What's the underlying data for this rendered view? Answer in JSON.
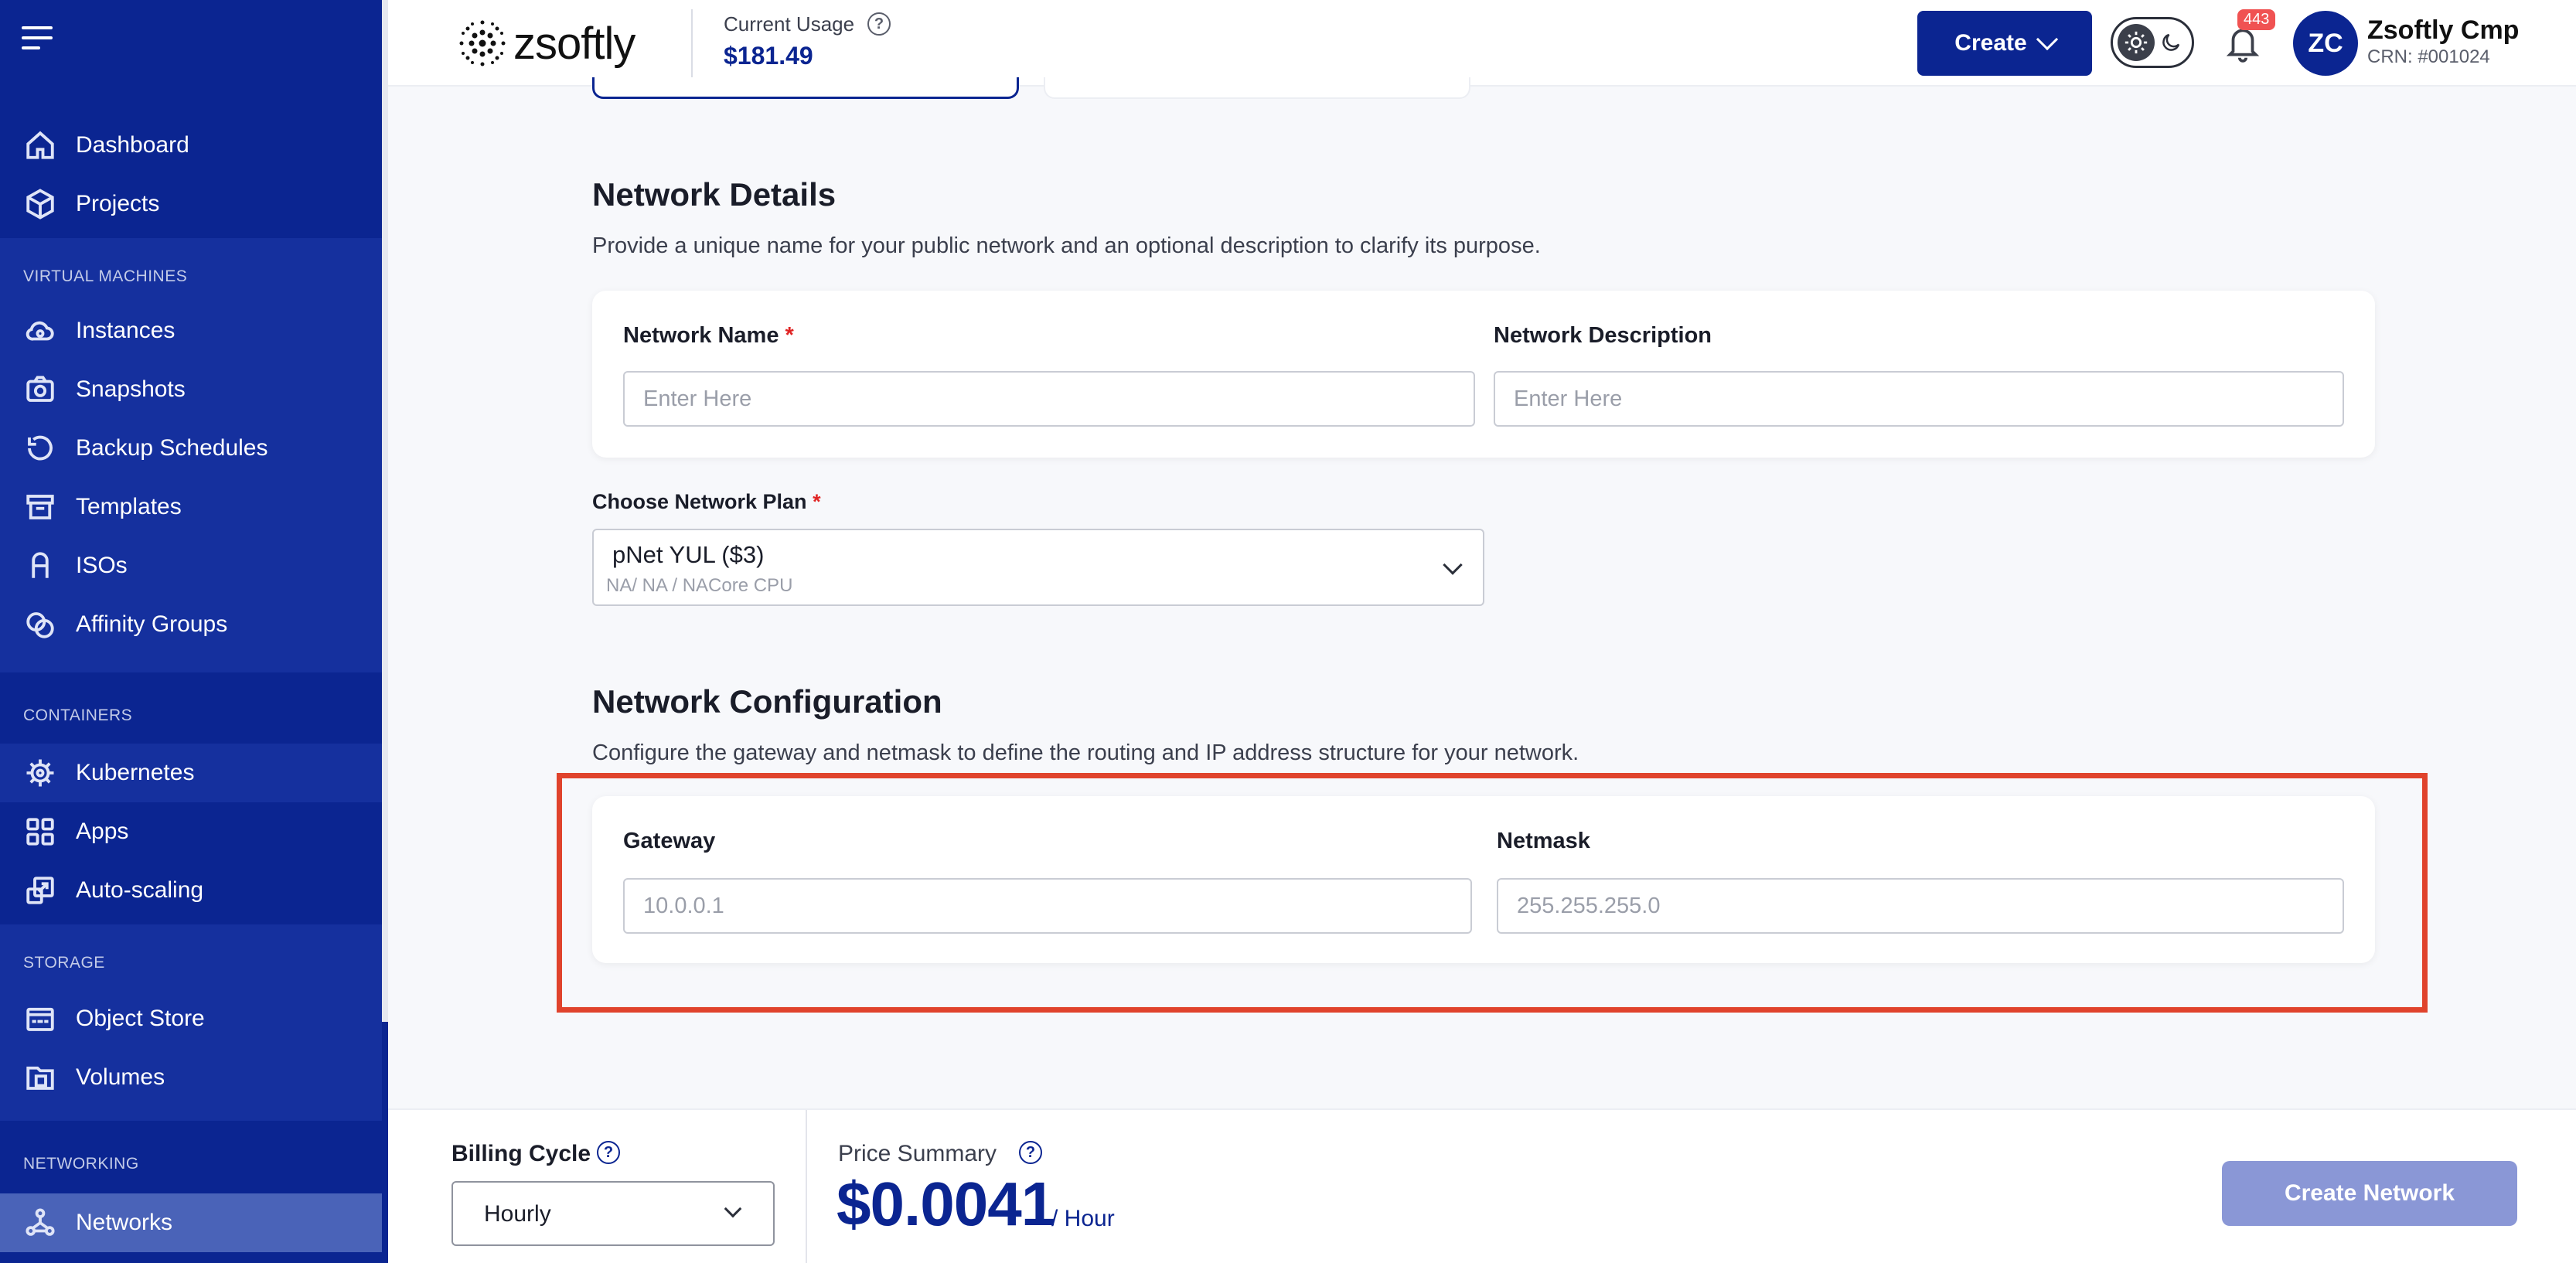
{
  "header": {
    "logo_text": "zsoftly",
    "usage_label": "Current Usage",
    "usage_value": "$181.49",
    "create_label": "Create",
    "notification_count": "443",
    "avatar_initials": "ZC",
    "user_name": "Zsoftly Cmp",
    "user_crn": "CRN: #001024"
  },
  "sidebar": {
    "top_items": [
      {
        "label": "Dashboard",
        "icon": "home-icon"
      },
      {
        "label": "Projects",
        "icon": "cube-icon"
      }
    ],
    "sections": [
      {
        "title": "VIRTUAL MACHINES",
        "items": [
          {
            "label": "Instances",
            "icon": "cloud-icon"
          },
          {
            "label": "Snapshots",
            "icon": "camera-icon"
          },
          {
            "label": "Backup Schedules",
            "icon": "history-icon"
          },
          {
            "label": "Templates",
            "icon": "archive-icon"
          },
          {
            "label": "ISOs",
            "icon": "disc-icon"
          },
          {
            "label": "Affinity Groups",
            "icon": "affinity-icon"
          }
        ]
      },
      {
        "title": "CONTAINERS",
        "items": [
          {
            "label": "Kubernetes",
            "icon": "helm-icon"
          },
          {
            "label": "Apps",
            "icon": "grid-icon"
          },
          {
            "label": "Auto-scaling",
            "icon": "scale-icon"
          }
        ]
      },
      {
        "title": "STORAGE",
        "items": [
          {
            "label": "Object Store",
            "icon": "bucket-icon"
          },
          {
            "label": "Volumes",
            "icon": "volume-icon"
          }
        ]
      },
      {
        "title": "NETWORKING",
        "items": [
          {
            "label": "Networks",
            "icon": "network-icon",
            "active": true
          }
        ]
      }
    ]
  },
  "network_details": {
    "title": "Network Details",
    "description": "Provide a unique name for your public network and an optional description to clarify its purpose.",
    "name_label": "Network Name",
    "required_mark": "*",
    "name_placeholder": "Enter Here",
    "description_label": "Network Description",
    "description_placeholder": "Enter Here"
  },
  "network_plan": {
    "label": "Choose Network Plan",
    "required_mark": "*",
    "selected": "pNet YUL ($3)",
    "selected_specs": "NA/ NA / NACore CPU"
  },
  "network_config": {
    "title": "Network Configuration",
    "description": "Configure the gateway and netmask to define the routing and IP address structure for your network.",
    "gateway_label": "Gateway",
    "gateway_placeholder": "10.0.0.1",
    "netmask_label": "Netmask",
    "netmask_placeholder": "255.255.255.0"
  },
  "footer": {
    "billing_label": "Billing Cycle",
    "billing_value": "Hourly",
    "price_label": "Price Summary",
    "price_value": "$0.0041",
    "price_unit": "/ Hour",
    "submit_label": "Create Network"
  },
  "colors": {
    "primary": "#0b2591",
    "highlight": "#e0432c",
    "required": "#e02424",
    "disabled_button": "#8a97d6"
  }
}
